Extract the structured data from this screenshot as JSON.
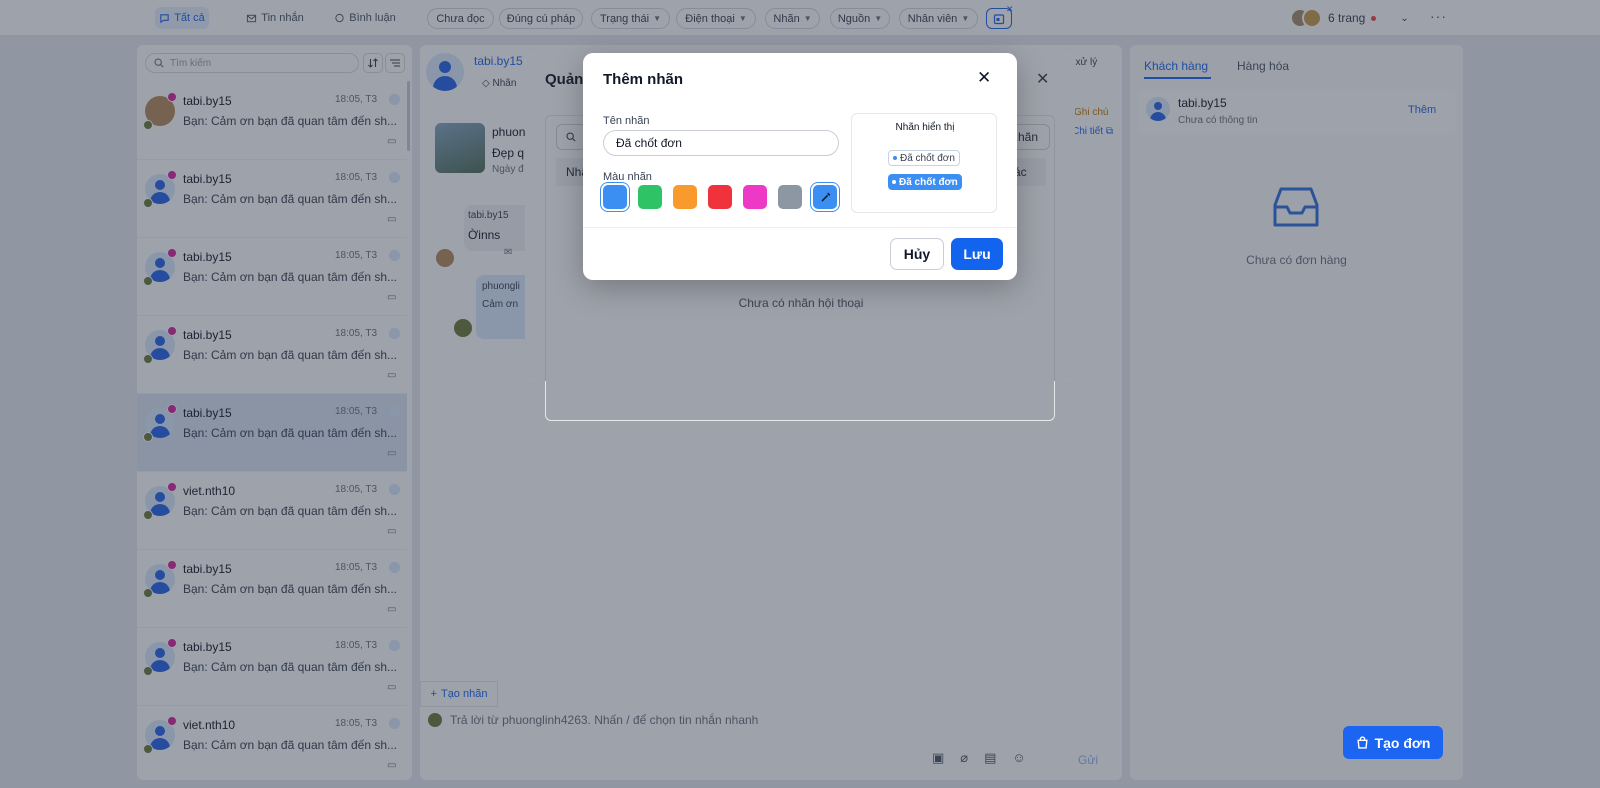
{
  "topbar": {
    "segments": [
      "Tất cả",
      "Tin nhắn",
      "Bình luận"
    ],
    "filters": [
      "Chưa đọc",
      "Đúng cú pháp",
      "Trạng thái",
      "Điện thoại",
      "Nhãn",
      "Nguồn",
      "Nhân viên"
    ],
    "pages_label": "6 trang"
  },
  "sidebar": {
    "search_placeholder": "Tìm kiếm",
    "conversations": [
      {
        "name": "tabi.by15",
        "time": "18:05, T3",
        "message": "Bạn: Cảm ơn bạn đã quan tâm đến sh..."
      },
      {
        "name": "tabi.by15",
        "time": "18:05, T3",
        "message": "Bạn: Cảm ơn bạn đã quan tâm đến sh..."
      },
      {
        "name": "tabi.by15",
        "time": "18:05, T3",
        "message": "Bạn: Cảm ơn bạn đã quan tâm đến sh..."
      },
      {
        "name": "tabi.by15",
        "time": "18:05, T3",
        "message": "Bạn: Cảm ơn bạn đã quan tâm đến sh..."
      },
      {
        "name": "tabi.by15",
        "time": "18:05, T3",
        "message": "Bạn: Cảm ơn bạn đã quan tâm đến sh..."
      },
      {
        "name": "viet.nth10",
        "time": "18:05, T3",
        "message": "Bạn: Cảm ơn bạn đã quan tâm đến sh..."
      },
      {
        "name": "tabi.by15",
        "time": "18:05, T3",
        "message": "Bạn: Cảm ơn bạn đã quan tâm đến sh..."
      },
      {
        "name": "tabi.by15",
        "time": "18:05, T3",
        "message": "Bạn: Cảm ơn bạn đã quan tâm đến sh..."
      },
      {
        "name": "viet.nth10",
        "time": "18:05, T3",
        "message": "Bạn: Cảm ơn bạn đã quan tâm đến sh..."
      }
    ]
  },
  "chat": {
    "header_name": "tabi.by15",
    "header_tag": "Nhãn",
    "status_right": "Đã xử lý",
    "note_tab": "Ghi chú",
    "detail_link": "Chi tiết",
    "post_author": "phuong",
    "post_caption": "Đẹp q",
    "post_date": "Ngày đ",
    "msg_sender": "tabi.by15",
    "msg_text": "Ờinns",
    "reply_sender": "phuongli",
    "reply_text": "Cảm ơn",
    "create_tag_label": "Tạo nhãn",
    "reply_placeholder": "Trả lời từ phuonglinh4263. Nhấn / để chọn tin nhắn nhanh",
    "send_label": "Gửi"
  },
  "manage_modal": {
    "title": "Quản",
    "button_partial": "hãn",
    "table_col_first": "Nhã",
    "table_col_last": "ác",
    "empty_text": "Chưa có nhãn hội thoại"
  },
  "add_tag_modal": {
    "title": "Thêm nhãn",
    "name_label": "Tên nhãn",
    "name_value": "Đã chốt đơn",
    "color_label": "Màu nhãn",
    "colors": [
      "#3b8ff3",
      "#2ec466",
      "#f99a2c",
      "#f0323c",
      "#ee38c6",
      "#8c97a3"
    ],
    "selected_color": "#3b8ff3",
    "preview_title": "Nhãn hiển thị",
    "preview_outline": "Đã chốt đơn",
    "preview_filled": "Đã chốt đơn",
    "cancel_label": "Hủy",
    "save_label": "Lưu"
  },
  "right_panel": {
    "tabs": [
      "Khách hàng",
      "Hàng hóa"
    ],
    "customer_name": "tabi.by15",
    "customer_info": "Chưa có thông tin",
    "add_label": "Thêm",
    "empty_orders": "Chưa có đơn hàng",
    "create_order_label": "Tạo đơn"
  },
  "colors": {
    "accent": "#1c64f2",
    "instagram": "#d6249f"
  }
}
